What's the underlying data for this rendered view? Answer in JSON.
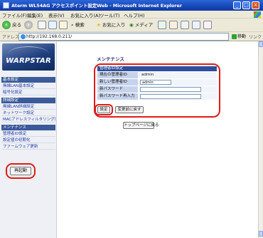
{
  "window": {
    "title": "Aterm WL54AG アクセスポイント設定Web - Microsoft Internet Explorer",
    "caption_buttons": {
      "minimize": "_",
      "maximize": "□",
      "close": "×"
    }
  },
  "menu": [
    "ファイル(F)",
    "編集(E)",
    "表示(V)",
    "お気に入り(A)",
    "ツール(T)",
    "ヘルプ(H)"
  ],
  "toolbar": {
    "back": "戻る",
    "back_icon": "back-arrow",
    "forward_icon": "forward-arrow",
    "search": "検索",
    "favorites": "お気に入り",
    "media": "メディア"
  },
  "address": {
    "label": "アドレス(D)",
    "url": "http://192.168.0.211/",
    "go": "移動",
    "links": "リンク »"
  },
  "sidebar": {
    "logo_text": "WARPSTAR",
    "sections": [
      {
        "label": "基本設定",
        "items": [
          "無線LAN基本設定",
          "暗号化設定"
        ]
      },
      {
        "label": "詳細設定",
        "items": [
          "無線LAN詳細設定",
          "ネットワーク設定",
          "MACアドレスフィルタリング設定"
        ]
      },
      {
        "label": "メンテナンス",
        "items": [
          "管理者ID設定",
          "設定値の初期化",
          "ファームウェア更新"
        ]
      }
    ],
    "reboot_button": "再起動"
  },
  "main": {
    "heading": "メンテナンス",
    "form_caption": "管理者ID設定",
    "rows": [
      {
        "label": "現在の管理者ID",
        "value": "admin"
      },
      {
        "label": "新しい管理者ID",
        "input_value": "admin"
      },
      {
        "label": "新パスワード",
        "input_value": ""
      },
      {
        "label": "新パスワード再入力",
        "input_value": ""
      }
    ],
    "set_button": "設定",
    "reset_button": "変更前に戻す",
    "top_button": "トップページに戻る"
  },
  "colors": {
    "highlight_ring": "#e01b1b",
    "nav_section": "#3b5a99",
    "titlebar": "#1746b6"
  }
}
